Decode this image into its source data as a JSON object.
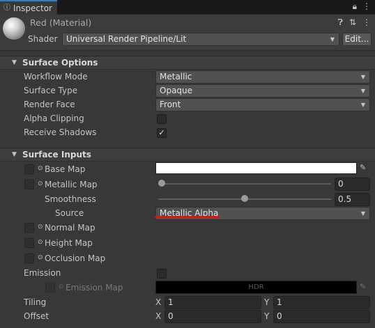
{
  "tab": {
    "title": "Inspector",
    "icon": "info-icon"
  },
  "tab_tools": {
    "lock_icon": "lock-icon",
    "menu_icon": "kebab-menu-icon"
  },
  "material": {
    "name": "Red (Material)",
    "icons": [
      "help-icon",
      "settings-sliders-icon",
      "kebab-menu-icon"
    ],
    "shader_label": "Shader",
    "shader_value": "Universal Render Pipeline/Lit",
    "edit_label": "Edit..."
  },
  "surface_options": {
    "title": "Surface Options",
    "rows": {
      "workflow_mode": {
        "label": "Workflow Mode",
        "value": "Metallic"
      },
      "surface_type": {
        "label": "Surface Type",
        "value": "Opaque"
      },
      "render_face": {
        "label": "Render Face",
        "value": "Front"
      },
      "alpha_clipping": {
        "label": "Alpha Clipping",
        "checked": false
      },
      "receive_shadows": {
        "label": "Receive Shadows",
        "checked": true,
        "check_glyph": "✓"
      }
    }
  },
  "surface_inputs": {
    "title": "Surface Inputs",
    "base_map": {
      "label": "Base Map",
      "color": "#ffffff"
    },
    "metallic_map": {
      "label": "Metallic Map",
      "value": "0",
      "level": 0.0
    },
    "smoothness": {
      "label": "Smoothness",
      "value": "0.5",
      "level": 0.5
    },
    "source": {
      "label": "Source",
      "value": "Metallic Alpha",
      "annotation_color": "#e01414"
    },
    "normal_map": {
      "label": "Normal Map"
    },
    "height_map": {
      "label": "Height Map"
    },
    "occlusion_map": {
      "label": "Occlusion Map"
    },
    "emission": {
      "label": "Emission",
      "checked": false
    },
    "emission_map": {
      "label": "Emission Map",
      "hdr_text": "HDR"
    },
    "tiling": {
      "label": "Tiling",
      "x_label": "X",
      "x": "1",
      "y_label": "Y",
      "y": "1"
    },
    "offset": {
      "label": "Offset",
      "x_label": "X",
      "x": "0",
      "y_label": "Y",
      "y": "0"
    }
  },
  "colors": {
    "background": "#383838",
    "tab_accent": "#3a79bb",
    "annotation": "#e01414"
  }
}
